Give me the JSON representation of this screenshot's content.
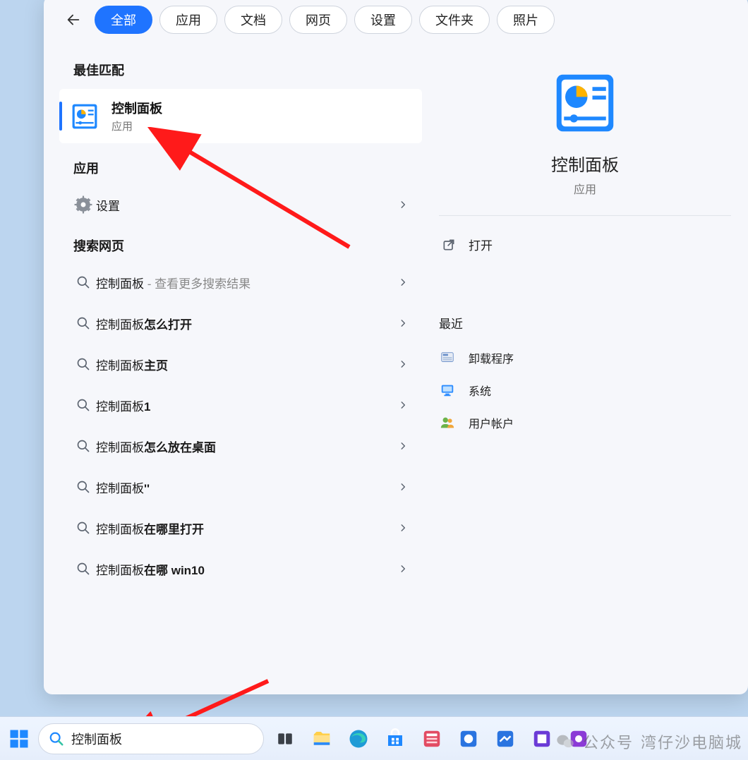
{
  "tabs": {
    "items": [
      "全部",
      "应用",
      "文档",
      "网页",
      "设置",
      "文件夹",
      "照片"
    ],
    "active_index": 0
  },
  "left": {
    "best_match_heading": "最佳匹配",
    "best_match": {
      "title": "控制面板",
      "subtitle": "应用"
    },
    "apps_heading": "应用",
    "apps": [
      {
        "label": "设置"
      }
    ],
    "web_heading": "搜索网页",
    "web": [
      {
        "prefix": "控制面板",
        "suffix": "",
        "hint": " - 查看更多搜索结果"
      },
      {
        "prefix": "控制面板",
        "suffix": "怎么打开",
        "hint": ""
      },
      {
        "prefix": "控制面板",
        "suffix": "主页",
        "hint": ""
      },
      {
        "prefix": "控制面板",
        "suffix": "1",
        "hint": ""
      },
      {
        "prefix": "控制面板",
        "suffix": "怎么放在桌面",
        "hint": ""
      },
      {
        "prefix": "控制面板",
        "suffix": "''",
        "hint": ""
      },
      {
        "prefix": "控制面板",
        "suffix": "在哪里打开",
        "hint": ""
      },
      {
        "prefix": "控制面板",
        "suffix": "在哪 win10",
        "hint": ""
      }
    ]
  },
  "right": {
    "title": "控制面板",
    "subtitle": "应用",
    "open_label": "打开",
    "recent_heading": "最近",
    "recent": [
      {
        "icon": "uninstall-icon",
        "label": "卸载程序"
      },
      {
        "icon": "system-icon",
        "label": "系统"
      },
      {
        "icon": "users-icon",
        "label": "用户帐户"
      }
    ]
  },
  "taskbar": {
    "search_value": "控制面板"
  },
  "watermark": {
    "prefix_label": "公众号",
    "name": "湾仔沙电脑城"
  }
}
